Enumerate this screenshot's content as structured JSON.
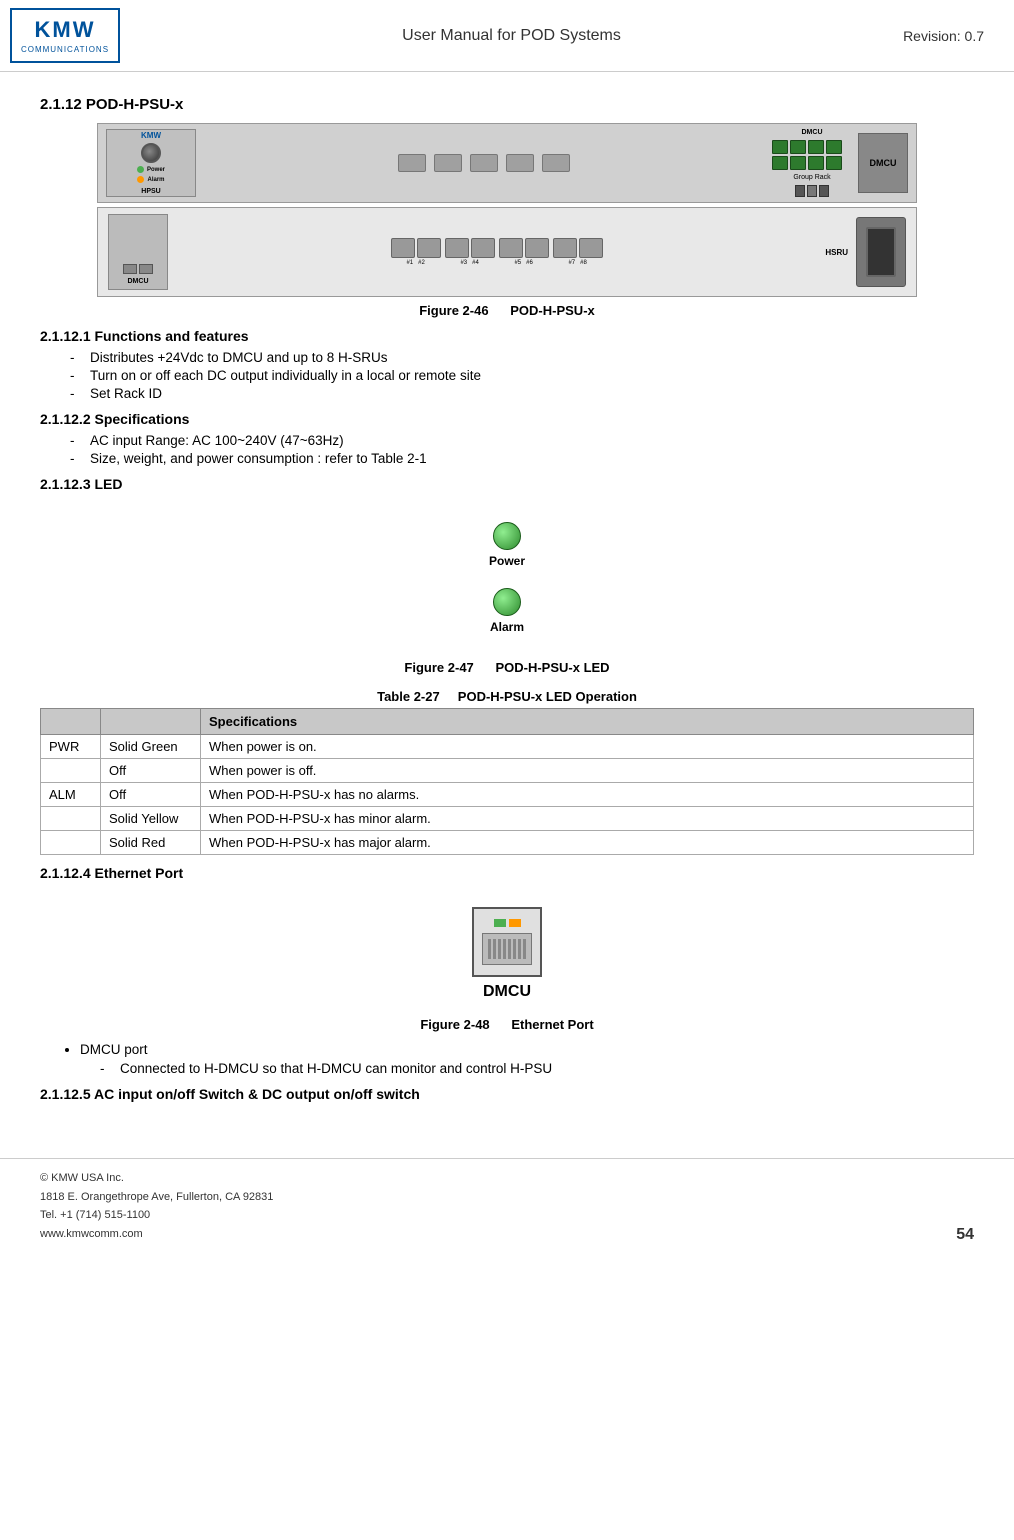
{
  "header": {
    "logo_kmw": "KMW",
    "logo_comm": "COMMUNICATIONS",
    "title": "User Manual for POD Systems",
    "revision": "Revision: 0.7"
  },
  "section_212": {
    "heading": "2.1.12   POD-H-PSU-x"
  },
  "figure46": {
    "label": "Figure 2-46",
    "caption": "POD-H-PSU-x"
  },
  "section_2121": {
    "heading": "2.1.12.1 Functions and features",
    "items": [
      "Distributes +24Vdc to DMCU and up to 8 H-SRUs",
      "Turn on or off each DC output individually in a local or remote site",
      "Set Rack ID"
    ]
  },
  "section_2122": {
    "heading": "2.1.12.2 Specifications",
    "items": [
      "AC input Range: AC 100~240V (47~63Hz)",
      "Size, weight, and power consumption : refer to Table 2-1"
    ]
  },
  "section_2123": {
    "heading": "2.1.12.3 LED",
    "led_power_label": "Power",
    "led_alarm_label": "Alarm"
  },
  "figure47": {
    "label": "Figure 2-47",
    "caption": "POD-H-PSU-x LED"
  },
  "table227": {
    "label": "Table 2-27",
    "caption": "POD-H-PSU-x LED Operation",
    "col_header": "Specifications",
    "rows": [
      {
        "id": "PWR",
        "sub": "Solid Green",
        "spec": "When power is on."
      },
      {
        "id": "",
        "sub": "Off",
        "spec": "When power is off."
      },
      {
        "id": "ALM",
        "sub": "Off",
        "spec": "When POD-H-PSU-x has no alarms."
      },
      {
        "id": "",
        "sub": "Solid Yellow",
        "spec": "When POD-H-PSU-x has minor alarm."
      },
      {
        "id": "",
        "sub": "Solid Red",
        "spec": "When POD-H-PSU-x has major alarm."
      }
    ]
  },
  "section_2124": {
    "heading": "2.1.12.4 Ethernet Port"
  },
  "figure48": {
    "eth_label": "DMCU",
    "label": "Figure 2-48",
    "caption": "Ethernet Port"
  },
  "eth_bullet": {
    "item": "DMCU port",
    "sub_item": "Connected to H-DMCU so that H-DMCU can monitor and control H-PSU"
  },
  "section_2125": {
    "heading": "2.1.12.5 AC input on/off Switch & DC output on/off switch"
  },
  "footer": {
    "copyright": "© KMW USA Inc.",
    "address": "1818 E. Orangethrope Ave, Fullerton, CA 92831",
    "tel": "Tel. +1 (714) 515-1100",
    "website": "www.kmwcomm.com",
    "page": "54"
  }
}
